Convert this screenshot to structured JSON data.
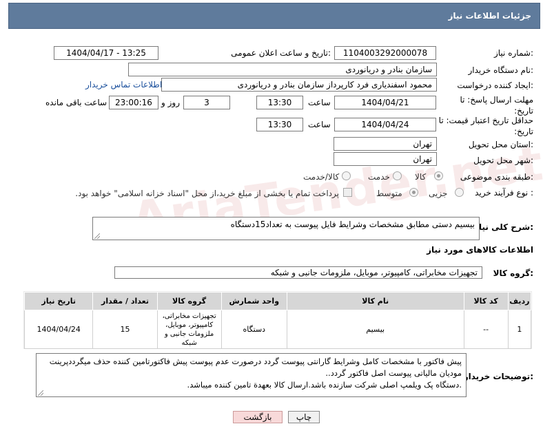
{
  "header": {
    "title": "جزئیات اطلاعات نیاز"
  },
  "fields": {
    "need_number_label": "شماره نیاز:",
    "need_number": "1104003292000078",
    "announce_label": "تاریخ و ساعت اعلان عمومی:",
    "announce_value": "1404/04/17 - 13:25",
    "buyer_org_label": "نام دستگاه خریدار:",
    "buyer_org": "سازمان بنادر و دریانوردی",
    "creator_label": "ایجاد کننده درخواست:",
    "creator": "محمود اسفندیاری فرد کارپرداز سازمان بنادر و دریانوردی",
    "contact_link": "اطلاعات تماس خریدار",
    "deadline_label": "مهلت ارسال پاسخ: تا تاریخ:",
    "deadline_date": "1404/04/21",
    "time_label": "ساعت",
    "deadline_time": "13:30",
    "days_value": "3",
    "days_label": "روز و",
    "remaining_value": "23:00:16",
    "remaining_label": "ساعت باقی مانده",
    "price_valid_label": "حداقل تاریخ اعتبار قیمت: تا تاریخ:",
    "price_valid_date": "1404/04/24",
    "price_valid_time": "13:30",
    "province_label": "استان محل تحویل:",
    "province": "تهران",
    "city_label": "شهر محل تحویل:",
    "city": "تهران",
    "category_label": "طبقه بندی موضوعی:",
    "category_options": [
      "کالا",
      "خدمت",
      "کالا/خدمت"
    ],
    "process_label": "نوع فرآیند خرید :",
    "process_options": [
      "جزیی",
      "متوسط"
    ],
    "payment_note": "پرداخت تمام یا بخشی از مبلغ خرید،از محل \"اسناد خزانه اسلامی\" خواهد بود."
  },
  "description": {
    "label": "شرح کلی نیاز:",
    "value": "بیسیم دستی مطابق مشخصات وشرایط فایل پیوست به تعداد15دستگاه"
  },
  "goods_section": {
    "title": "اطلاعات کالاهای مورد نیاز",
    "group_label": "گروه کالا:",
    "group_value": "تجهیزات مخابراتی، کامپیوتر، موبایل، ملزومات جانبی و شبکه"
  },
  "table": {
    "headers": [
      "ردیف",
      "کد کالا",
      "نام کالا",
      "واحد شمارش",
      "گروه کالا",
      "تعداد / مقدار",
      "تاریخ نیاز"
    ],
    "rows": [
      [
        "1",
        "--",
        "بیسیم",
        "دستگاه",
        "تجهیزات مخابراتی، کامپیوتر، موبایل، ملزومات جانبی و شبکه",
        "15",
        "1404/04/24"
      ]
    ]
  },
  "buyer_notes": {
    "label": "توضیحات خریدار:",
    "lines": [
      "پیش فاکتور با مشخصات کامل وشرایط گارانتی پیوست گردد درصورت عدم پیوست پیش فاکتورتامین کننده حذف میگرددپرینت",
      "مودیان مالیاتی پیوست اصل فاکتور گردد..",
      ".دستگاه پک ویلمپ اصلی شرکت سازنده باشد.ارسال کالا بعهدة تامین کننده میباشد."
    ]
  },
  "buttons": {
    "print": "چاپ",
    "back": "بازگشت"
  },
  "watermark": "AriaTender.net",
  "colors": {
    "header_bg": "#5f7b9c",
    "link": "#1a4f9c",
    "back_btn": "#f8d9d9"
  }
}
